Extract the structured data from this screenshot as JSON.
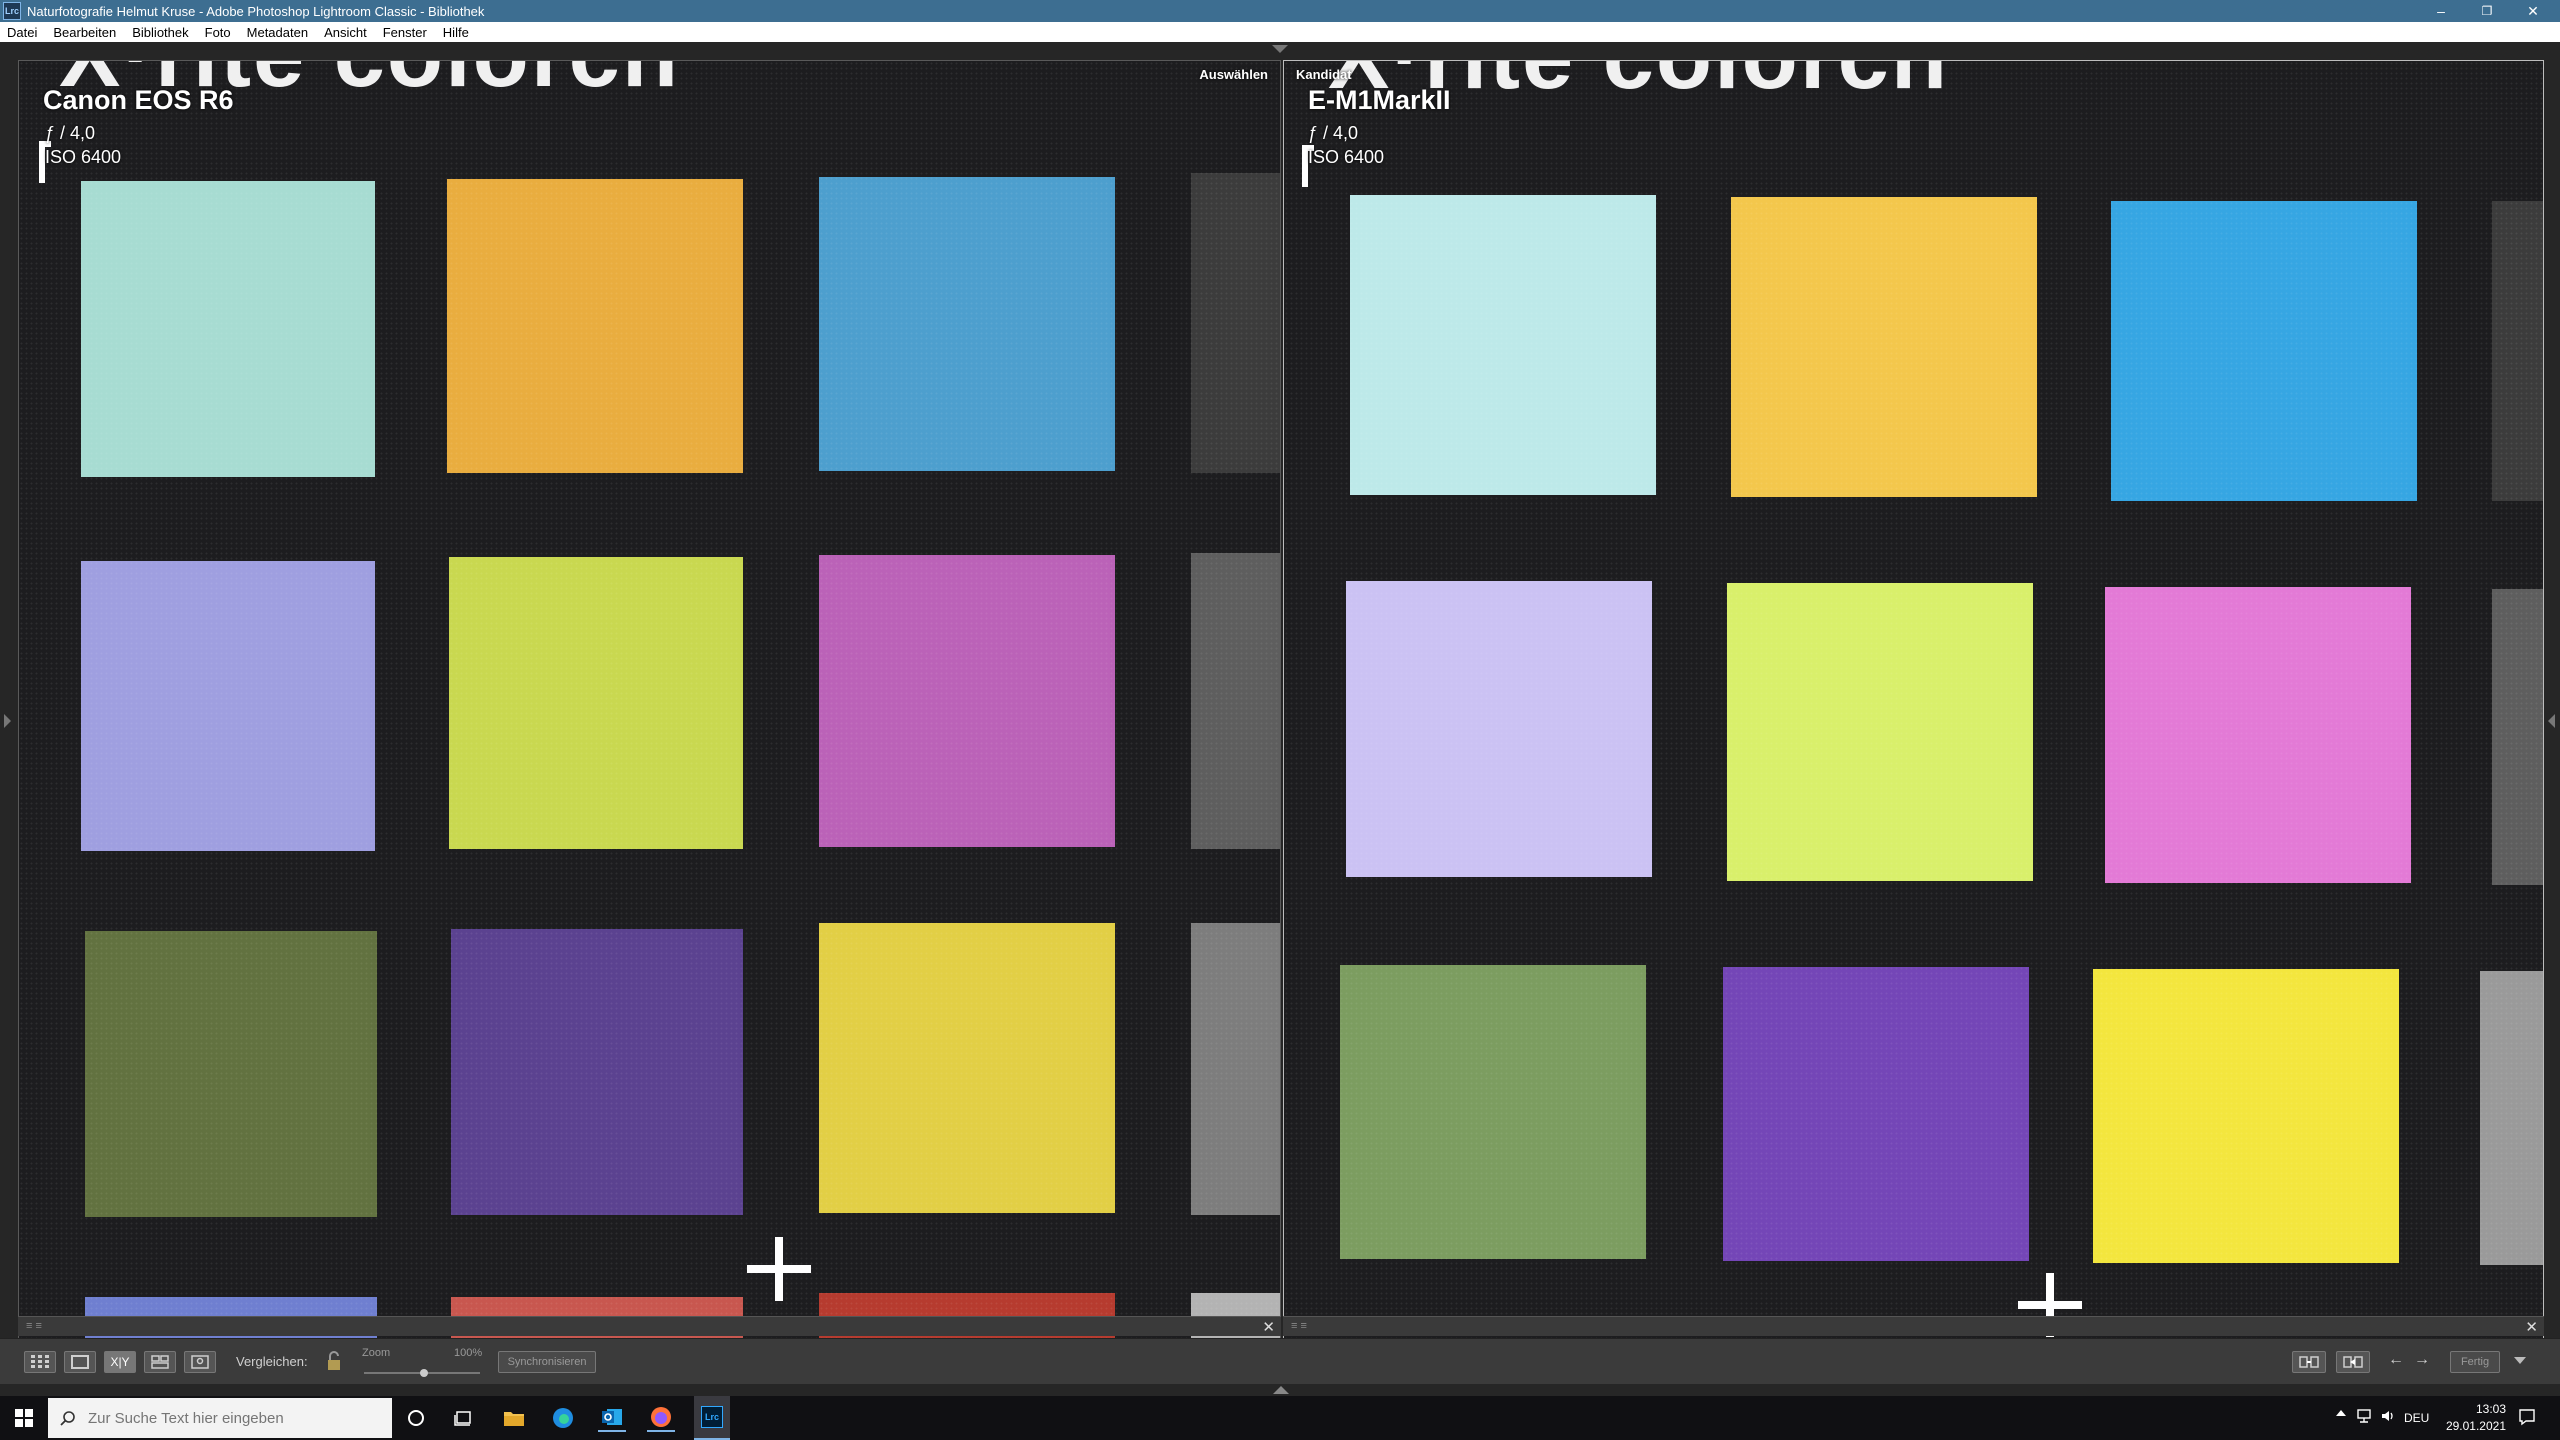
{
  "window": {
    "title": "Naturfotografie Helmut Kruse - Adobe Photoshop Lightroom Classic - Bibliothek",
    "app_icon": "Lrc",
    "controls": [
      "–",
      "❐",
      "✕"
    ]
  },
  "menu": [
    "Datei",
    "Bearbeiten",
    "Bibliothek",
    "Foto",
    "Metadaten",
    "Ansicht",
    "Fenster",
    "Hilfe"
  ],
  "left_pane": {
    "tag": "Auswählen",
    "camera": "Canon EOS R6",
    "aperture": "ƒ / 4,0",
    "iso": "ISO 6400",
    "logo": "X·rite colorch"
  },
  "right_pane": {
    "tag": "Kandidat",
    "camera": "E-M1MarkII",
    "aperture": "ƒ / 4,0",
    "iso": "ISO 6400",
    "logo": "X·rite colorch"
  },
  "toolbar": {
    "compare_label": "Vergleichen:",
    "zoom_label": "Zoom",
    "zoom_value": "100%",
    "sync_button": "Synchronisieren",
    "done_button": "Fertig"
  },
  "taskbar": {
    "search_placeholder": "Zur Suche Text hier eingeben",
    "lang": "DEU",
    "time": "13:03",
    "date": "29.01.2021"
  },
  "colors": {
    "titlebar": "#3d6e91",
    "left_swatches": [
      "#a7dcd2",
      "#e9ad3f",
      "#4d9fce",
      "#9f9fe0",
      "#c9d850",
      "#bb62b8",
      "#627240",
      "#5b4290",
      "#e2cf45"
    ],
    "right_swatches": [
      "#bde9e9",
      "#f3c74c",
      "#36a6e3",
      "#cbc2f3",
      "#d9f06b",
      "#e37ad6",
      "#7c9d60",
      "#7446b7",
      "#f3e63e"
    ]
  }
}
